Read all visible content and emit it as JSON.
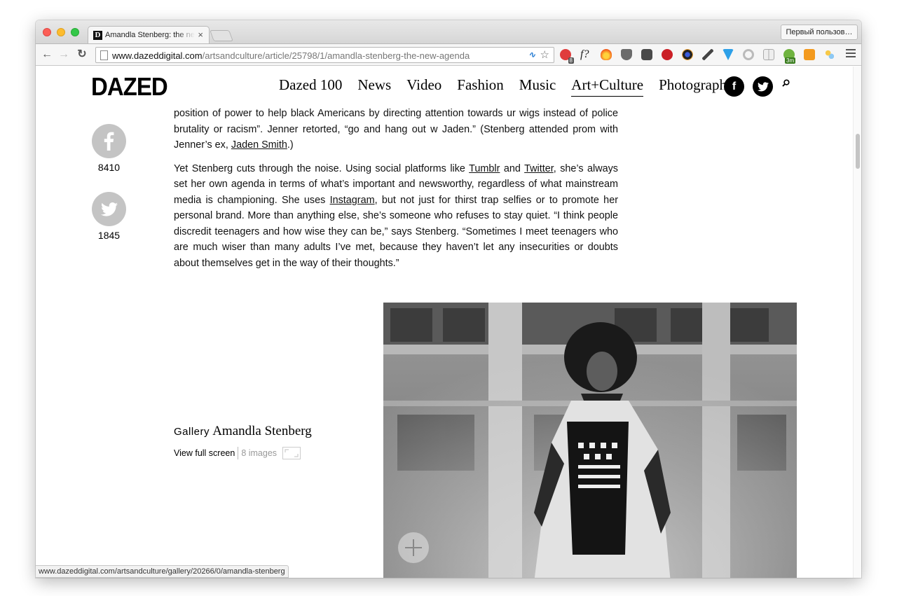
{
  "browser": {
    "tab_title": "Amandla Stenberg: the new agenda",
    "tab_favicon": "D",
    "tab_close": "×",
    "profile_button": "Первый пользов…",
    "url_host": "www.dazeddigital.com",
    "url_path": "/artsandculture/article/25798/1/amandla-stenberg-the-new-agenda",
    "status_url": "www.dazeddigital.com/artsandculture/gallery/20266/0/amandla-stenberg",
    "extension_badge_count": "8",
    "extension_badge_time": "3m",
    "extension_f_label": "f?"
  },
  "site": {
    "logo": "DAZED",
    "nav": [
      {
        "label": "Dazed 100"
      },
      {
        "label": "News"
      },
      {
        "label": "Video"
      },
      {
        "label": "Fashion"
      },
      {
        "label": "Music"
      },
      {
        "label": "Art+Culture",
        "active": true
      },
      {
        "label": "Photography"
      }
    ]
  },
  "share": {
    "facebook_count": "8410",
    "twitter_count": "1845"
  },
  "article": {
    "p1_a": "position of power to help black Americans by directing attention towards ur wigs instead of police brutality or racism”. Jenner retorted, “go and hang out w Jaden.” (Stenberg attended prom with Jenner’s ex, ",
    "p1_link": "Jaden Smith",
    "p1_b": ".)",
    "p2_a": "Yet Stenberg cuts through the noise. Using social platforms like ",
    "p2_link1": "Tumblr",
    "p2_b": " and ",
    "p2_link2": "Twitter",
    "p2_c": ", she’s always set her own agenda in terms of what’s important and newsworthy, regardless of what mainstream media is championing. She uses ",
    "p2_link3": "Instagram",
    "p2_d": ", but not just for thirst trap selfies or to promote her personal brand. More than anything else, she’s someone who refuses to stay quiet. “I think people discredit teenagers and how wise they can be,” says Stenberg. “Sometimes I meet teenagers who are much wiser than many adults I’ve met, because they haven’t let any insecurities or doubts about themselves get in the way of their thoughts.”"
  },
  "gallery": {
    "label_word": "Gallery",
    "title": "Amandla Stenberg",
    "view_full": "View full screen",
    "image_count": "8 images"
  },
  "colors": {
    "share_grey": "#c4c4c4",
    "link": "#111111"
  }
}
